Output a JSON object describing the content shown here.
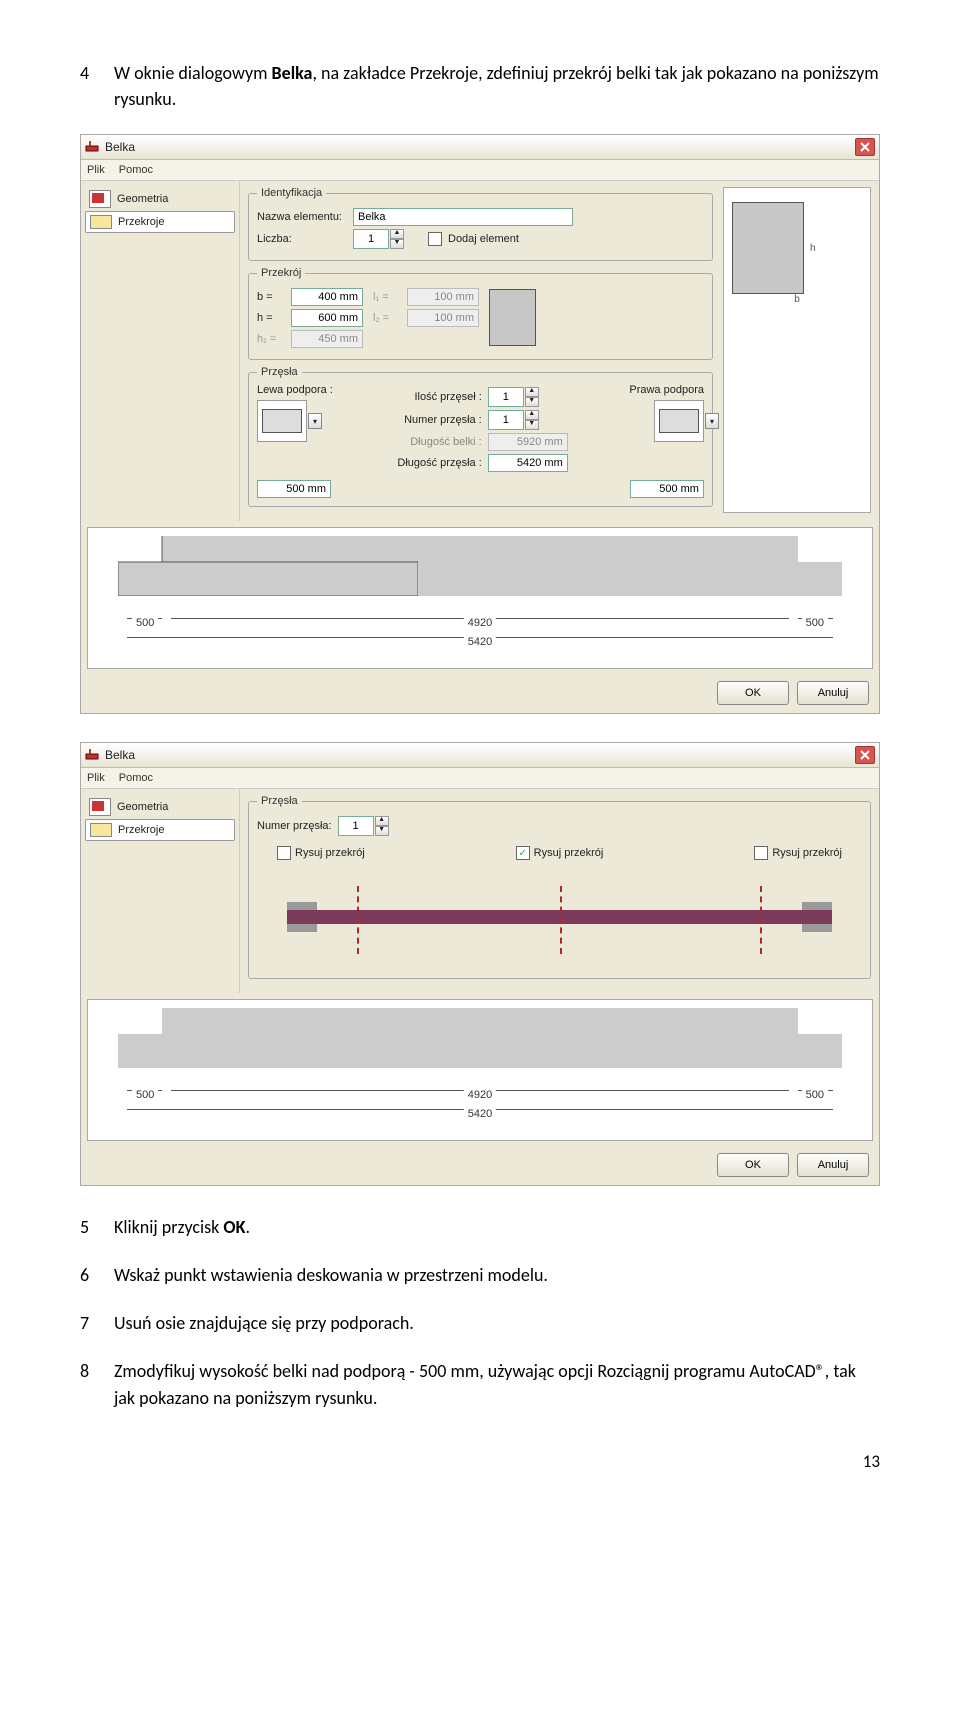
{
  "steps": {
    "s4_num": "4",
    "s4_a": "W oknie dialogowym ",
    "s4_b": "Belka",
    "s4_c": ", na zakładce Przekroje, zdefiniuj przekrój belki tak jak pokazano na poniższym rysunku.",
    "s5_num": "5",
    "s5_a": "Kliknij przycisk ",
    "s5_b": "OK",
    "s5_c": ".",
    "s6_num": "6",
    "s6": "Wskaż punkt wstawienia deskowania w przestrzeni modelu.",
    "s7_num": "7",
    "s7": "Usuń osie znajdujące się przy podporach.",
    "s8_num": "8",
    "s8": "Zmodyfikuj wysokość belki nad podporą - 500 mm, używając opcji Rozciągnij programu AutoCAD®, tak jak pokazano na poniższym rysunku."
  },
  "win": {
    "title": "Belka",
    "menu": {
      "plik": "Plik",
      "pomoc": "Pomoc"
    },
    "sidebar": {
      "geometria": "Geometria",
      "przekroje": "Przekroje"
    },
    "btn": {
      "ok": "OK",
      "anuluj": "Anuluj"
    }
  },
  "id": {
    "legend": "Identyfikacja",
    "nazwa_lbl": "Nazwa elementu:",
    "nazwa_val": "Belka",
    "liczba_lbl": "Liczba:",
    "liczba_val": "1",
    "dodaj": "Dodaj element"
  },
  "sec": {
    "legend": "Przekrój",
    "b_lbl": "b =",
    "b_val": "400 mm",
    "h_lbl": "h =",
    "h_val": "600 mm",
    "h1_lbl": "h₁ =",
    "h1_val": "450 mm",
    "l1_lbl": "l₁ =",
    "l1_val": "100 mm",
    "l2_lbl": "l₂ =",
    "l2_val": "100 mm",
    "h_dim": "h",
    "b_dim": "b"
  },
  "span": {
    "legend": "Przęsła",
    "lewa": "Lewa podpora :",
    "prawa": "Prawa podpora",
    "ilosc_lbl": "Ilość przęseł :",
    "ilosc_val": "1",
    "numer_lbl": "Numer przęsła :",
    "numer_val": "1",
    "dlb_lbl": "Długość belki :",
    "dlb_val": "5920 mm",
    "dlp_lbl": "Długość przęsła :",
    "dlp_val": "5420 mm",
    "supL": "500 mm",
    "supR": "500 mm"
  },
  "fig": {
    "d500": "500",
    "d4920": "4920",
    "d5420": "5420"
  },
  "win2": {
    "legend": "Przęsła",
    "numer_lbl": "Numer przęsła:",
    "numer_val": "1",
    "rysuj": "Rysuj przekrój"
  },
  "page": "13"
}
